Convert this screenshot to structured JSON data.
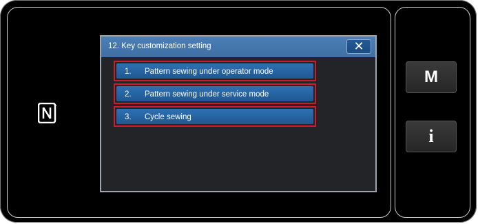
{
  "dialog": {
    "title": "12.  Key customization setting",
    "close_label": "✕",
    "items": [
      {
        "number": "1.",
        "label": "Pattern sewing under operator mode"
      },
      {
        "number": "2.",
        "label": "Pattern sewing under service mode"
      },
      {
        "number": "3.",
        "label": "Cycle sewing"
      }
    ]
  },
  "side_buttons": {
    "mode_label": "M",
    "info_label": "i"
  },
  "icons": {
    "nfc": "nfc-n-mark-icon"
  },
  "colors": {
    "header": "#4b7fb6",
    "item": "#2f70b3",
    "highlight": "#d01c2a",
    "dialog_bg": "#222428"
  }
}
